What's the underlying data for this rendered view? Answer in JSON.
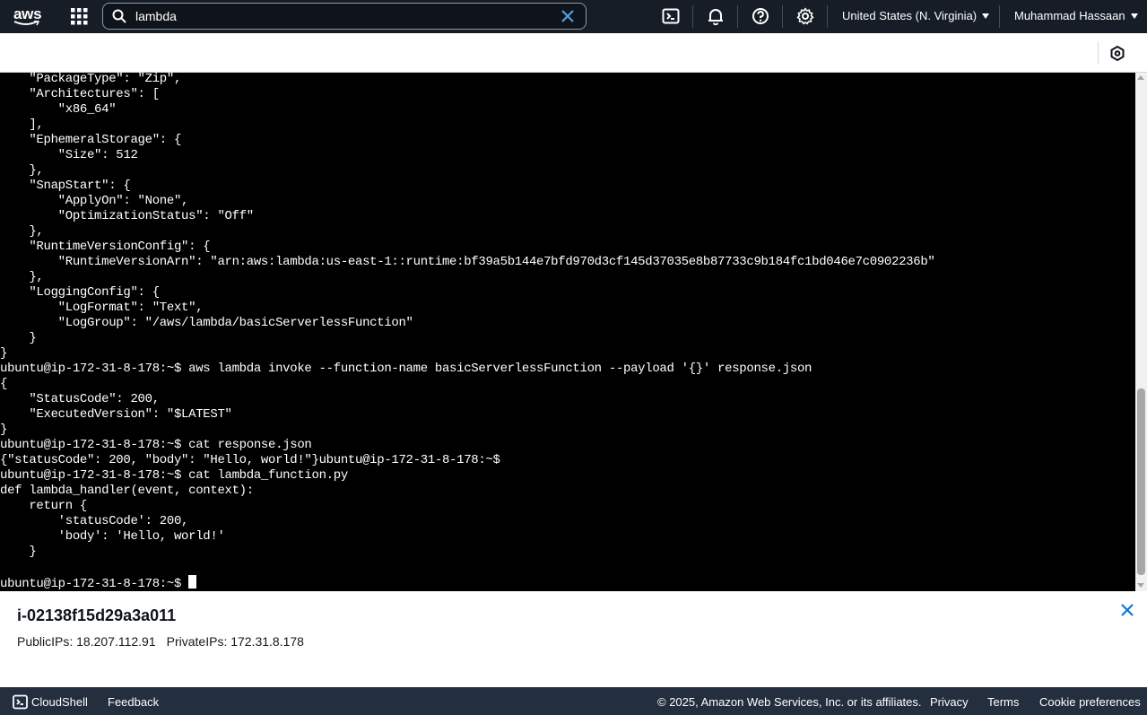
{
  "topnav": {
    "logo_text": "aws",
    "search": {
      "value": "lambda",
      "placeholder": "Search"
    },
    "region": "United States (N. Virginia)",
    "user": "Muhammad Hassaan",
    "icons": [
      "services-grid-icon",
      "search-icon",
      "clear-icon",
      "cloudshell-icon",
      "bell-icon",
      "help-icon",
      "gear-icon"
    ]
  },
  "terminal": {
    "lines": [
      "    \"PackageType\": \"Zip\",",
      "    \"Architectures\": [",
      "        \"x86_64\"",
      "    ],",
      "    \"EphemeralStorage\": {",
      "        \"Size\": 512",
      "    },",
      "    \"SnapStart\": {",
      "        \"ApplyOn\": \"None\",",
      "        \"OptimizationStatus\": \"Off\"",
      "    },",
      "    \"RuntimeVersionConfig\": {",
      "        \"RuntimeVersionArn\": \"arn:aws:lambda:us-east-1::runtime:bf39a5b144e7bfd970d3cf145d37035e8b87733c9b184fc1bd046e7c0902236b\"",
      "    },",
      "    \"LoggingConfig\": {",
      "        \"LogFormat\": \"Text\",",
      "        \"LogGroup\": \"/aws/lambda/basicServerlessFunction\"",
      "    }",
      "}",
      "ubuntu@ip-172-31-8-178:~$ aws lambda invoke --function-name basicServerlessFunction --payload '{}' response.json",
      "{",
      "    \"StatusCode\": 200,",
      "    \"ExecutedVersion\": \"$LATEST\"",
      "}",
      "ubuntu@ip-172-31-8-178:~$ cat response.json",
      "{\"statusCode\": 200, \"body\": \"Hello, world!\"}ubuntu@ip-172-31-8-178:~$",
      "ubuntu@ip-172-31-8-178:~$ cat lambda_function.py",
      "def lambda_handler(event, context):",
      "    return {",
      "        'statusCode': 200,",
      "        'body': 'Hello, world!'",
      "    }",
      ""
    ],
    "prompt": "ubuntu@ip-172-31-8-178:~$ "
  },
  "instance": {
    "id": "i-02138f15d29a3a011",
    "public_ips": "PublicIPs: 18.207.112.91",
    "private_ips": "PrivateIPs: 172.31.8.178"
  },
  "footer": {
    "cloudshell": "CloudShell",
    "feedback": "Feedback",
    "copyright": "© 2025, Amazon Web Services, Inc. or its affiliates.",
    "privacy": "Privacy",
    "terms": "Terms",
    "cookies": "Cookie preferences"
  },
  "colors": {
    "nav_bg": "#161d26",
    "accent_blue": "#0972d3",
    "footer_bg": "#232f3e",
    "terminal_bg": "#000000",
    "search_clear": "#539fe5"
  }
}
